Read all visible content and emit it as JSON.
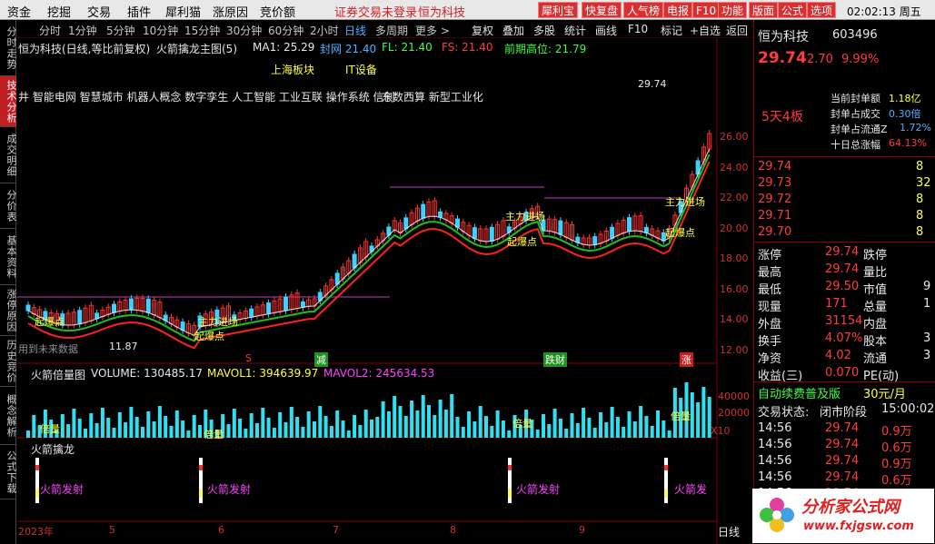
{
  "menubar": {
    "items": [
      "资金",
      "挖掘",
      "交易",
      "插件",
      "犀利猫",
      "涨原因",
      "竞价额"
    ],
    "status": "证券交易未登录",
    "stock": "恒为科技",
    "buttons": [
      "犀利宝",
      "快复盘",
      "人气榜",
      "电报",
      "F10",
      "功能",
      "版面",
      "公式",
      "选项"
    ],
    "clock": "02:02:13 周五"
  },
  "left_tabs": [
    "分时走势",
    "技术分析",
    "成交明细",
    "分价表",
    "基本资料",
    "涨停原因",
    "历史竞价",
    "概念解析",
    "公式下载"
  ],
  "period_bar": {
    "items": [
      "分时",
      "1分钟",
      "5分钟",
      "10分钟",
      "15分钟",
      "30分钟",
      "60分钟",
      "2小时",
      "日线",
      "多周期",
      "更多 >"
    ],
    "active": "日线",
    "tools": [
      "复权",
      "叠加",
      "多股",
      "统计",
      "画线",
      "F10",
      "标记",
      "+自选",
      "返回"
    ]
  },
  "main": {
    "title": "恒为科技(日线,等比前复权)",
    "formula": "火箭擒龙主图(5)",
    "ma1": "MA1: 25.29",
    "ma_lbl": "封网 21.40",
    "fl": "FL: 21.40",
    "fs": "FS: 21.40",
    "prev_high": "前期高位: 21.79",
    "sector": "上海板块",
    "industry": "IT设备",
    "concepts": "东数西算 新型工业化",
    "concept_prefix": "井 智能电网 智慧城市 机器人概念 数字孪生 人工智能 工业互联 操作系统 信创",
    "future": "用到未来数据",
    "low_label": "11.87",
    "high_label": "29.74",
    "tags": [
      "主力进场",
      "起爆点",
      "主力进场",
      "起爆点",
      "主力进场",
      "起爆点",
      "主力进场",
      "起爆点"
    ],
    "marks": [
      "S",
      "减",
      "跌财",
      "涨"
    ]
  },
  "y_axis": {
    "ticks": [
      "26.00",
      "24.00",
      "22.00",
      "20.00",
      "18.00",
      "16.00",
      "14.00",
      "12.00"
    ]
  },
  "volume": {
    "title": "火箭倍量图",
    "vol": "VOLUME: 130485.17",
    "mavol1": "MAVOL1: 394639.97",
    "mavol2": "MAVOL2: 245634.53",
    "labels": [
      "倍量",
      "倍量",
      "倍量",
      "倍量"
    ],
    "ticks": [
      "60000",
      "40000",
      "20000",
      "X10"
    ]
  },
  "rocket": {
    "title": "火箭擒龙",
    "labels": [
      "火箭发射",
      "火箭发射",
      "火箭发射",
      "火箭发"
    ]
  },
  "x_axis": {
    "labels": [
      "2023年",
      "5",
      "6",
      "7",
      "8",
      "9"
    ],
    "period": "日线"
  },
  "right": {
    "name": "恒为科技",
    "code": "603496",
    "price": "29.74",
    "change": "2.70",
    "pct": "9.99%",
    "seal_order": "1.18亿",
    "seal_traded": "0.30倍",
    "seal_float": "1.72%",
    "ten_day": "64.13%",
    "seal_order_lbl": "当前封单额",
    "seal_traded_lbl": "封单占成交",
    "seal_float_lbl": "封单占流通Z",
    "ten_day_lbl": "十日总涨幅",
    "streak": "5天4板",
    "book": [
      {
        "p": "29.74",
        "v": "8"
      },
      {
        "p": "29.73",
        "v": "32"
      },
      {
        "p": "29.72",
        "v": "8"
      },
      {
        "p": "29.71",
        "v": "8"
      },
      {
        "p": "29.70",
        "v": "8"
      }
    ],
    "stats": [
      [
        "涨停",
        "29.74",
        "跌停",
        ""
      ],
      [
        "最高",
        "29.74",
        "量比",
        ""
      ],
      [
        "最低",
        "29.50",
        "市值",
        "9"
      ],
      [
        "现量",
        "171",
        "总量",
        "1"
      ],
      [
        "外盘",
        "31154",
        "内盘",
        ""
      ],
      [
        "换手",
        "4.07%",
        "股本",
        "3"
      ],
      [
        "净资",
        "4.02",
        "流通",
        "3"
      ],
      [
        "收益(三)",
        "0.070",
        "PE(动)",
        ""
      ]
    ],
    "notice": "自动续费普及版",
    "notice_price": "30元/月",
    "trade_state_lbl": "交易状态:",
    "trade_state": "闭市阶段",
    "trade_time": "15:00:02",
    "ticks": [
      [
        "14:56",
        "29.74",
        "0.9万"
      ],
      [
        "14:56",
        "29.74",
        "0.6万"
      ],
      [
        "14:56",
        "29.74",
        "0.9万"
      ],
      [
        "14:56",
        "29.74",
        "0.6万"
      ],
      [
        "14:56",
        "29.74",
        "0.9万"
      ]
    ]
  },
  "watermark": "分析家公式网",
  "watermark_url": "www.fxjgsw.com"
}
